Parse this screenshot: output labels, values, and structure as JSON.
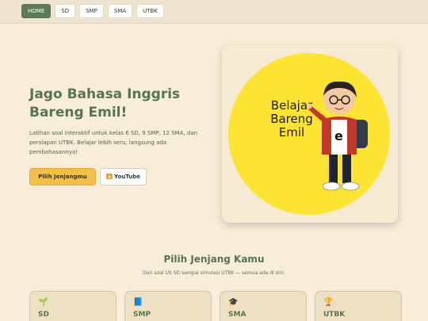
{
  "nav": {
    "items": [
      {
        "label": "HOME",
        "active": true
      },
      {
        "label": "SD"
      },
      {
        "label": "SMP"
      },
      {
        "label": "SMA"
      },
      {
        "label": "UTBK"
      }
    ]
  },
  "hero": {
    "title": "Jago Bahasa Inggris Bareng Emil!",
    "description": "Latihan soal interaktif untuk kelas 6 SD, 9 SMP, 12 SMA, dan persiapan UTBK. Belajar lebih seru, langsung ada pembahasannya!",
    "primary_button": "Pilih Jenjangmu",
    "youtube_button": "YouTube",
    "illustration_text": "Belajar Bareng Emil"
  },
  "levels_section": {
    "title": "Pilih Jenjang Kamu",
    "subtitle": "Dari soal US SD sampai simulasi UTBK — semua ada di sini.",
    "cards": [
      {
        "icon": "seedling-icon",
        "glyph": "🌱",
        "name": "SD"
      },
      {
        "icon": "book-icon",
        "glyph": "📘",
        "name": "SMP"
      },
      {
        "icon": "graduation-cap-icon",
        "glyph": "🎓",
        "name": "SMA"
      },
      {
        "icon": "trophy-icon",
        "glyph": "🏆",
        "name": "UTBK"
      }
    ]
  },
  "colors": {
    "background": "#f7edd9",
    "primary_green": "#58754f",
    "accent_yellow": "#f2c04a",
    "sun_yellow": "#fde433"
  }
}
